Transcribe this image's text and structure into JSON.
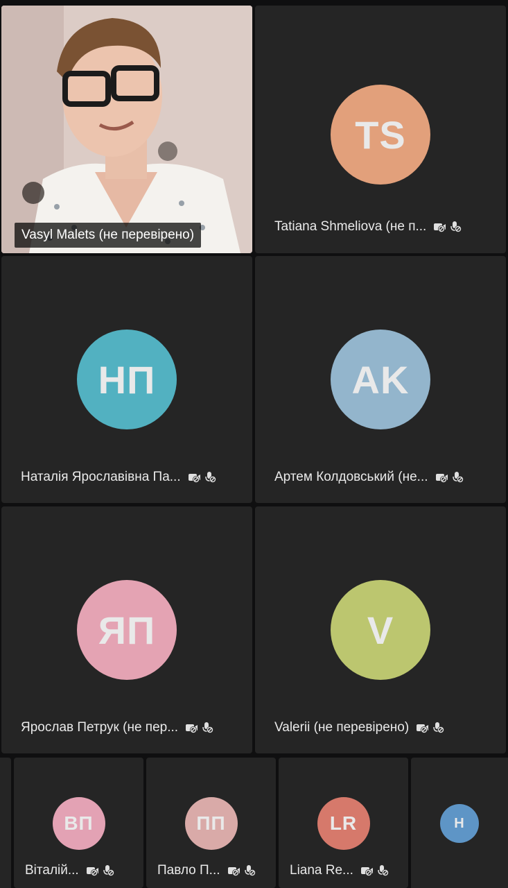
{
  "participants": [
    {
      "name": "Vasyl Malets (не перевірено)",
      "initials": "",
      "color": "",
      "has_video": true
    },
    {
      "name": "Tatiana Shmeliova (не п...",
      "initials": "TS",
      "color": "#e2a07b"
    },
    {
      "name": "Наталія Ярославівна Па...",
      "initials": "НП",
      "color": "#52b1c1"
    },
    {
      "name": "Артем Колдовський (не...",
      "initials": "AK",
      "color": "#93b5cc"
    },
    {
      "name": "Ярослав Петрук (не пер...",
      "initials": "ЯП",
      "color": "#e4a3b3"
    },
    {
      "name": "Valerii (не перевірено)",
      "initials": "V",
      "color": "#bcc66f"
    }
  ],
  "strip": [
    {
      "name": "Віталій...",
      "initials": "ВП",
      "color": "#e3a2b4"
    },
    {
      "name": "Павло П...",
      "initials": "ПП",
      "color": "#d9aaa8"
    },
    {
      "name": "Liana Re...",
      "initials": "LR",
      "color": "#d6796b"
    },
    {
      "name": "",
      "initials": "H",
      "color": "#5e95c6"
    }
  ]
}
